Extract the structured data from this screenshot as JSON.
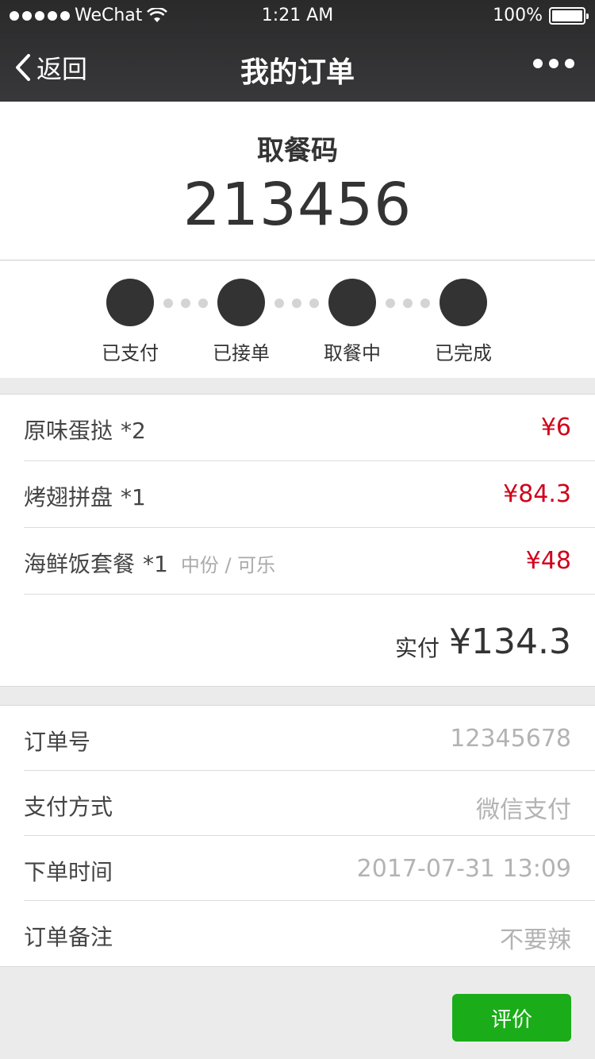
{
  "status_bar": {
    "carrier": "WeChat",
    "time": "1:21 AM",
    "battery": "100%"
  },
  "nav": {
    "back_label": "返回",
    "title": "我的订单"
  },
  "pickup": {
    "label": "取餐码",
    "code": "213456"
  },
  "progress": {
    "steps": [
      {
        "label": "已支付"
      },
      {
        "label": "已接单"
      },
      {
        "label": "取餐中"
      },
      {
        "label": "已完成"
      }
    ]
  },
  "items": [
    {
      "name": "原味蛋挞",
      "qty": "*2",
      "options": "",
      "price": "¥6"
    },
    {
      "name": "烤翅拼盘",
      "qty": "*1",
      "options": "",
      "price": "¥84.3"
    },
    {
      "name": "海鲜饭套餐",
      "qty": "*1",
      "options": "中份 / 可乐",
      "price": "¥48"
    }
  ],
  "total": {
    "label": "实付",
    "amount": "¥134.3"
  },
  "details": [
    {
      "key": "订单号",
      "value": "12345678"
    },
    {
      "key": "支付方式",
      "value": "微信支付"
    },
    {
      "key": "下单时间",
      "value": "2017-07-31 13:09"
    },
    {
      "key": "订单备注",
      "value": "不要辣"
    }
  ],
  "actions": {
    "rate_label": "评价"
  },
  "colors": {
    "price": "#d0021b",
    "button": "#1aad19",
    "nav_bg": "#2f2f30"
  }
}
